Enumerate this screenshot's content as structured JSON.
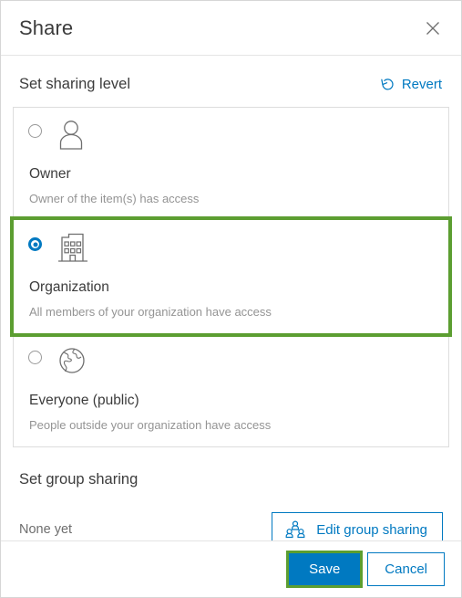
{
  "dialog": {
    "title": "Share",
    "close_icon": "close-icon"
  },
  "sharing_level": {
    "section_title": "Set sharing level",
    "revert": {
      "label": "Revert",
      "icon": "revert-circular-arrow-icon"
    },
    "options": [
      {
        "id": "owner",
        "label": "Owner",
        "description": "Owner of the item(s) has access",
        "icon": "person-icon",
        "selected": false,
        "highlighted": false
      },
      {
        "id": "organization",
        "label": "Organization",
        "description": "All members of your organization have access",
        "icon": "building-icon",
        "selected": true,
        "highlighted": true
      },
      {
        "id": "everyone",
        "label": "Everyone (public)",
        "description": "People outside your organization have access",
        "icon": "globe-icon",
        "selected": false,
        "highlighted": false
      }
    ]
  },
  "group_sharing": {
    "section_title": "Set group sharing",
    "status": "None yet",
    "edit_button": {
      "label": "Edit group sharing",
      "icon": "group-people-icon"
    }
  },
  "footer": {
    "save_label": "Save",
    "cancel_label": "Cancel",
    "save_highlighted": true
  },
  "colors": {
    "accent_blue": "#0079c1",
    "highlight_green": "#5c9e31",
    "text_primary": "#3c3c3c",
    "text_muted": "#949494",
    "border": "#dddddd"
  }
}
